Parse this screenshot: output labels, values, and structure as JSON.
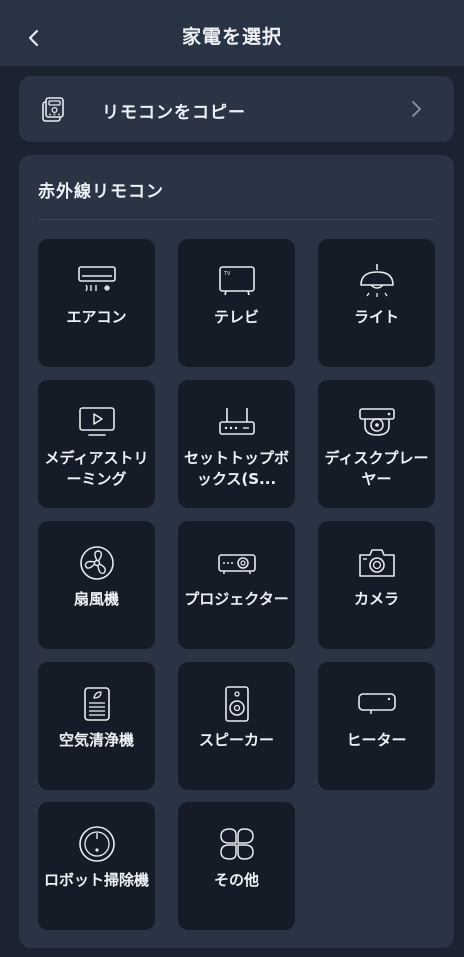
{
  "header": {
    "title": "家電を選択",
    "back_icon": "chevron-left-icon"
  },
  "copy_card": {
    "label": "リモコンをコピー",
    "icon": "remote-control-icon",
    "chevron_icon": "chevron-right-icon"
  },
  "ir_section": {
    "title": "赤外線リモコン",
    "devices": [
      {
        "label": "エアコン",
        "icon": "air-conditioner-icon"
      },
      {
        "label": "テレビ",
        "icon": "tv-icon"
      },
      {
        "label": "ライト",
        "icon": "ceiling-light-icon"
      },
      {
        "label": "メディアストリーミング",
        "icon": "media-streaming-icon"
      },
      {
        "label": "セットトップボックス(S...",
        "icon": "set-top-box-icon"
      },
      {
        "label": "ディスクプレーヤー",
        "icon": "disc-player-icon"
      },
      {
        "label": "扇風機",
        "icon": "fan-icon"
      },
      {
        "label": "プロジェクター",
        "icon": "projector-icon"
      },
      {
        "label": "カメラ",
        "icon": "camera-icon"
      },
      {
        "label": "空気清浄機",
        "icon": "air-purifier-icon"
      },
      {
        "label": "スピーカー",
        "icon": "speaker-icon"
      },
      {
        "label": "ヒーター",
        "icon": "heater-icon"
      },
      {
        "label": "ロボット掃除機",
        "icon": "robot-vacuum-icon"
      },
      {
        "label": "その他",
        "icon": "clover-others-icon"
      }
    ]
  },
  "colors": {
    "background": "#1b2331",
    "header": "#283343",
    "card": "#2a3445",
    "tile": "#151c27",
    "text": "#eef1f6"
  }
}
